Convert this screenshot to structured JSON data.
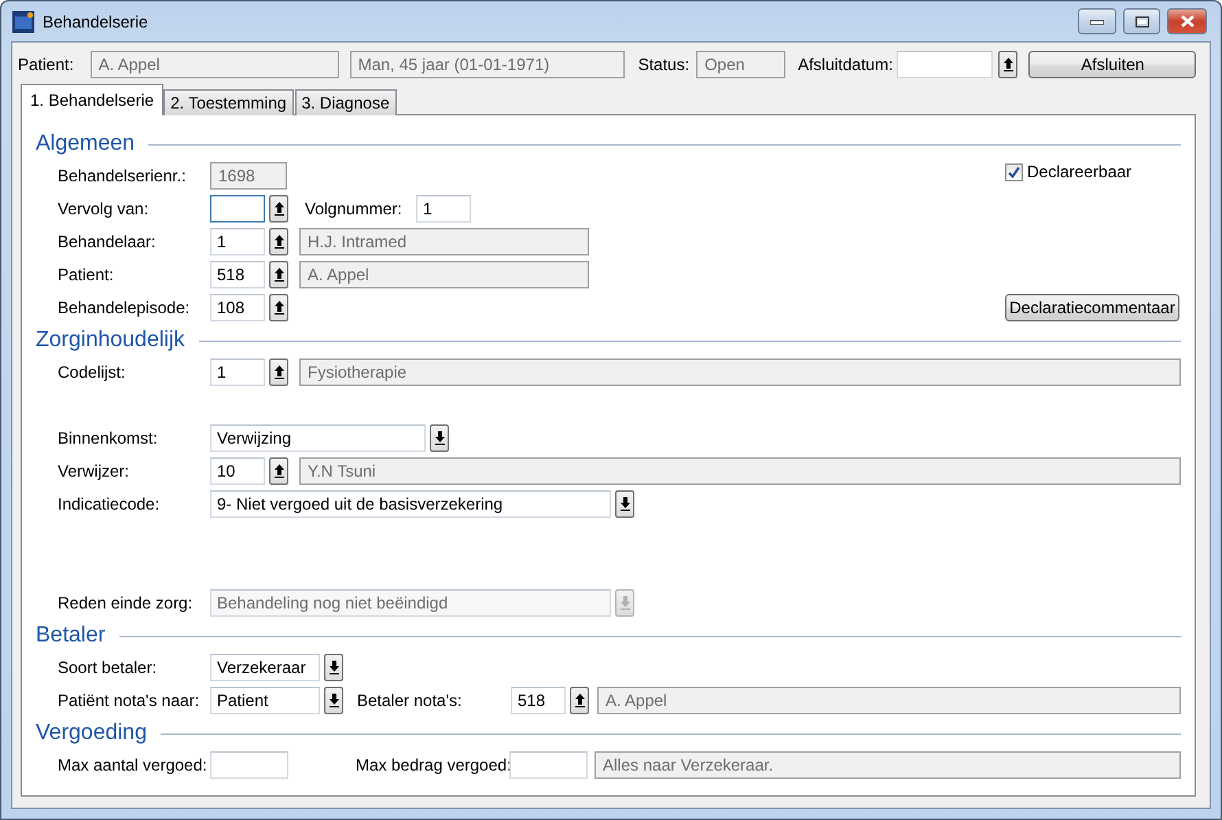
{
  "window": {
    "title": "Behandelserie"
  },
  "header": {
    "patient_label": "Patient:",
    "patient_name": "A. Appel",
    "patient_info": "Man, 45 jaar (01-01-1971)",
    "status_label": "Status:",
    "status": "Open",
    "close_date_label": "Afsluitdatum:",
    "close_button": "Afsluiten"
  },
  "tabs": [
    {
      "label": "1. Behandelserie",
      "selected": true
    },
    {
      "label": "2. Toestemming",
      "selected": false
    },
    {
      "label": "3. Diagnose",
      "selected": false
    }
  ],
  "sections": [
    {
      "title": "Algemeen",
      "side": [
        {
          "kind": "checkbox",
          "text": "Declareerbaar",
          "checked": true
        },
        {
          "kind": "button",
          "text": "Declaratiecommentaar"
        }
      ],
      "rows": [
        {
          "cells": [
            {
              "kind": "label",
              "text": "Behandelserienr.:"
            },
            {
              "kind": "readonly",
              "text": "1698"
            }
          ]
        },
        {
          "cells": [
            {
              "kind": "label",
              "text": "Vervolg van:"
            },
            {
              "kind": "input",
              "focused": true,
              "disabled": false
            },
            {
              "kind": "lookup"
            },
            {
              "kind": "label",
              "text": "Volgnummer:"
            },
            {
              "kind": "input",
              "value": "1",
              "focused": false,
              "disabled": false
            }
          ]
        },
        {
          "cells": [
            {
              "kind": "label",
              "text": "Behandelaar:"
            },
            {
              "kind": "input",
              "value": "1",
              "focused": false,
              "disabled": false
            },
            {
              "kind": "lookup"
            },
            {
              "kind": "readonly",
              "text": "H.J. Intramed"
            }
          ]
        },
        {
          "cells": [
            {
              "kind": "label",
              "text": "Patient:"
            },
            {
              "kind": "input",
              "value": "518",
              "focused": false,
              "disabled": false
            },
            {
              "kind": "lookup"
            },
            {
              "kind": "readonly",
              "text": "A. Appel"
            }
          ]
        },
        {
          "cells": [
            {
              "kind": "label",
              "text": "Behandelepisode:"
            },
            {
              "kind": "input",
              "value": "108",
              "focused": false,
              "disabled": false
            },
            {
              "kind": "lookup"
            }
          ]
        }
      ]
    },
    {
      "title": "Zorginhoudelijk",
      "rows": [
        {
          "cells": [
            {
              "kind": "label",
              "text": "Codelijst:"
            },
            {
              "kind": "input",
              "value": "1",
              "focused": false,
              "disabled": false
            },
            {
              "kind": "lookup"
            },
            {
              "kind": "readonly",
              "text": "Fysiotherapie"
            }
          ]
        },
        {
          "cells": [
            {
              "kind": "label",
              "text": "Binnenkomst:"
            },
            {
              "kind": "input",
              "value": "Verwijzing",
              "focused": false,
              "disabled": false
            },
            {
              "kind": "dropdown",
              "disabled": false
            }
          ]
        },
        {
          "cells": [
            {
              "kind": "label",
              "text": "Verwijzer:"
            },
            {
              "kind": "input",
              "value": "10",
              "focused": false,
              "disabled": false
            },
            {
              "kind": "lookup"
            },
            {
              "kind": "readonly",
              "text": "Y.N Tsuni"
            }
          ]
        },
        {
          "cells": [
            {
              "kind": "label",
              "text": "Indicatiecode:"
            },
            {
              "kind": "input",
              "value": "9- Niet vergoed uit de basisverzekering",
              "focused": false,
              "disabled": false
            },
            {
              "kind": "dropdown",
              "disabled": false
            }
          ]
        },
        {
          "cells": [
            {
              "kind": "label",
              "text": "Reden einde zorg:"
            },
            {
              "kind": "input",
              "value": "Behandeling nog niet beëindigd",
              "focused": false,
              "disabled": true
            },
            {
              "kind": "dropdown",
              "disabled": true
            }
          ]
        }
      ]
    },
    {
      "title": "Betaler",
      "rows": [
        {
          "cells": [
            {
              "kind": "label",
              "text": "Soort betaler:"
            },
            {
              "kind": "input",
              "value": "Verzekeraar",
              "focused": false,
              "disabled": false
            },
            {
              "kind": "dropdown",
              "disabled": false
            }
          ]
        },
        {
          "cells": [
            {
              "kind": "label",
              "text": "Patiënt nota's naar:"
            },
            {
              "kind": "input",
              "value": "Patient",
              "focused": false,
              "disabled": false
            },
            {
              "kind": "dropdown",
              "disabled": false
            },
            {
              "kind": "label",
              "text": "Betaler nota's:"
            },
            {
              "kind": "input",
              "value": "518",
              "focused": false,
              "disabled": false
            },
            {
              "kind": "lookup"
            },
            {
              "kind": "readonly",
              "text": "A. Appel"
            }
          ]
        }
      ]
    },
    {
      "title": "Vergoeding",
      "rows": [
        {
          "cells": [
            {
              "kind": "label",
              "text": "Max aantal vergoed:"
            },
            {
              "kind": "input",
              "focused": false
            },
            {
              "kind": "label",
              "text": "Max bedrag vergoed:"
            },
            {
              "kind": "input",
              "focused": false
            },
            {
              "kind": "readonly",
              "text": "Alles naar Verzekeraar."
            }
          ]
        }
      ]
    }
  ]
}
